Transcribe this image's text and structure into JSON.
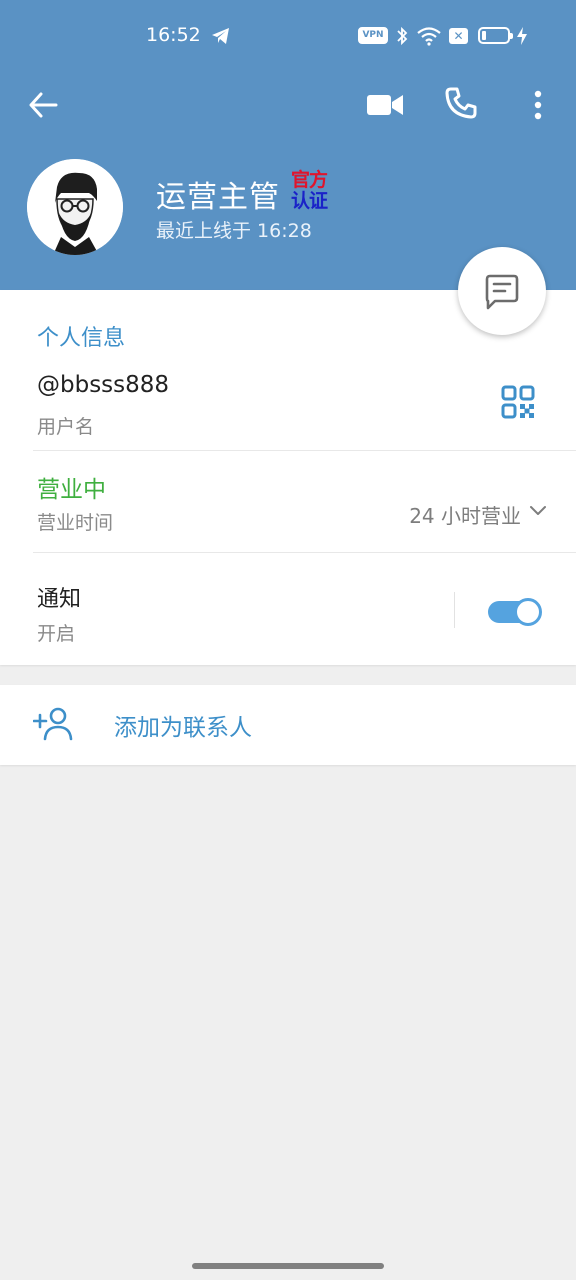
{
  "status_bar": {
    "time": "16:52",
    "vpn": "VPN",
    "sim": "✕"
  },
  "profile": {
    "name": "运营主管",
    "verified_line1": "官方",
    "verified_line2": "认证",
    "last_seen": "最近上线于 16:28"
  },
  "info": {
    "section_title": "个人信息",
    "username_value": "@bbsss888",
    "username_label": "用户名",
    "hours_status": "营业中",
    "hours_label": "营业时间",
    "hours_value": "24 小时营业",
    "notify_title": "通知",
    "notify_value": "开启",
    "notify_enabled": true
  },
  "actions": {
    "add_contact": "添加为联系人"
  },
  "colors": {
    "header": "#5a92c4",
    "accent": "#3d8fc9",
    "open_status": "#3faf3f",
    "toggle": "#55a3df"
  },
  "icons": [
    "telegram-icon",
    "bluetooth-icon",
    "wifi-icon",
    "battery-icon",
    "charging-icon",
    "back-arrow-icon",
    "video-call-icon",
    "phone-icon",
    "more-vert-icon",
    "message-icon",
    "qr-code-icon",
    "chevron-down-icon",
    "add-user-icon"
  ]
}
